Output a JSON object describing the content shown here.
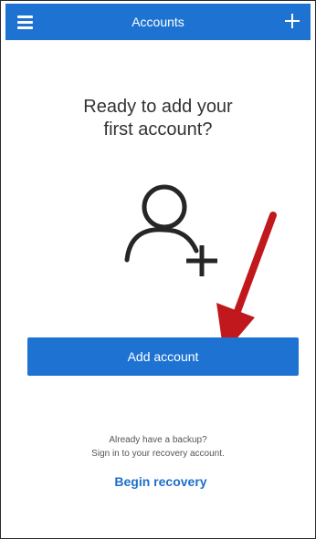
{
  "header": {
    "title": "Accounts",
    "menu_icon": "hamburger-menu-icon",
    "add_icon": "plus-icon",
    "color": "#1e73d2"
  },
  "main": {
    "heading": "Ready to add your\nfirst account?",
    "illustration_icon": "add-person-icon",
    "annotation_icon": "red-arrow-icon",
    "annotation_color": "#c0181c",
    "add_account_label": "Add account",
    "backup_line1": "Already have a backup?",
    "backup_line2": "Sign in to your recovery account.",
    "begin_recovery_label": "Begin recovery"
  }
}
